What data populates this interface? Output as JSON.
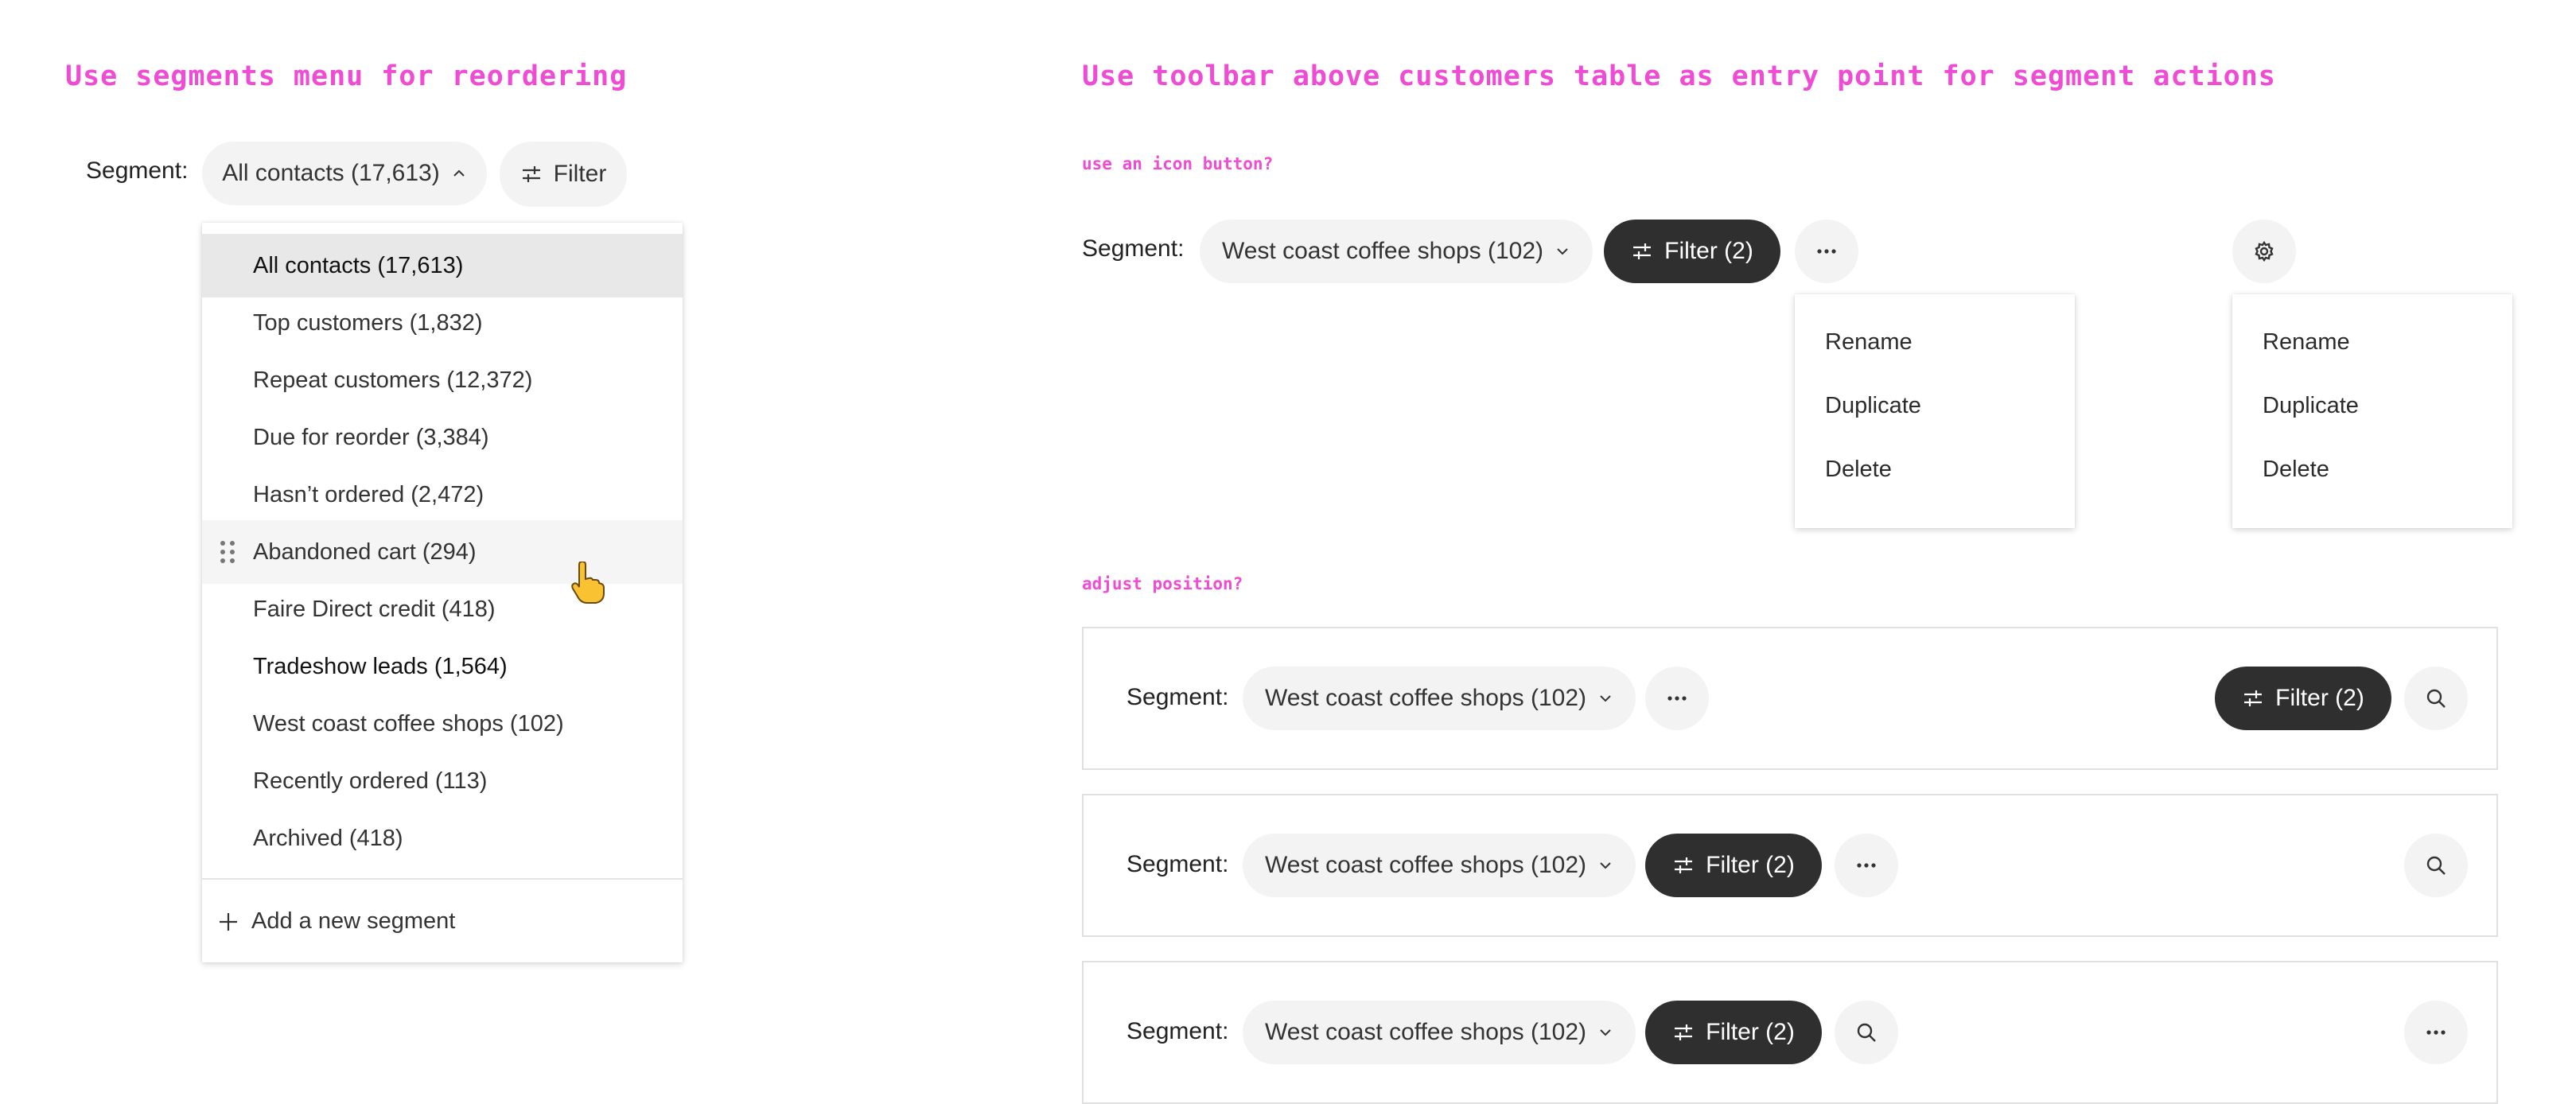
{
  "left": {
    "title": "Use segments menu for reordering",
    "segment_label": "Segment:",
    "segment_value": "All contacts (17,613)",
    "filter_label": "Filter",
    "dropdown": {
      "items": [
        {
          "label": "All contacts (17,613)"
        },
        {
          "label": "Top customers (1,832)"
        },
        {
          "label": "Repeat customers (12,372)"
        },
        {
          "label": "Due for reorder (3,384)"
        },
        {
          "label": "Hasn’t ordered (2,472)"
        },
        {
          "label": "Abandoned cart (294)"
        },
        {
          "label": "Faire Direct credit (418)"
        },
        {
          "label": "Tradeshow leads (1,564)"
        },
        {
          "label": "West coast coffee shops (102)"
        },
        {
          "label": "Recently ordered (113)"
        },
        {
          "label": "Archived (418)"
        }
      ],
      "add_label": "Add a new segment"
    }
  },
  "right": {
    "title": "Use toolbar above customers table as entry point for segment actions",
    "note_icon": "use an icon button?",
    "note_position": "adjust position?",
    "segment_label": "Segment:",
    "segment_value": "West coast coffee shops (102)",
    "filter_label": "Filter (2)",
    "more_label": "···",
    "menu_items": [
      "Rename",
      "Duplicate",
      "Delete"
    ]
  },
  "icons": {
    "filter": "sliders-icon",
    "chevron": "chevron-down-icon",
    "chevron_up": "chevron-up-icon",
    "more": "more-horizontal-icon",
    "settings": "gear-icon",
    "search": "search-icon",
    "drag": "drag-handle-icon",
    "add": "plus-icon",
    "cursor": "pointing-hand-cursor-icon"
  },
  "colors": {
    "accent_pink": "#f04bd5",
    "dark_button": "#2f2f2f",
    "pill_bg": "#f3f3f3",
    "selected_row": "#e8e8e8",
    "hover_row": "#f5f5f5"
  }
}
